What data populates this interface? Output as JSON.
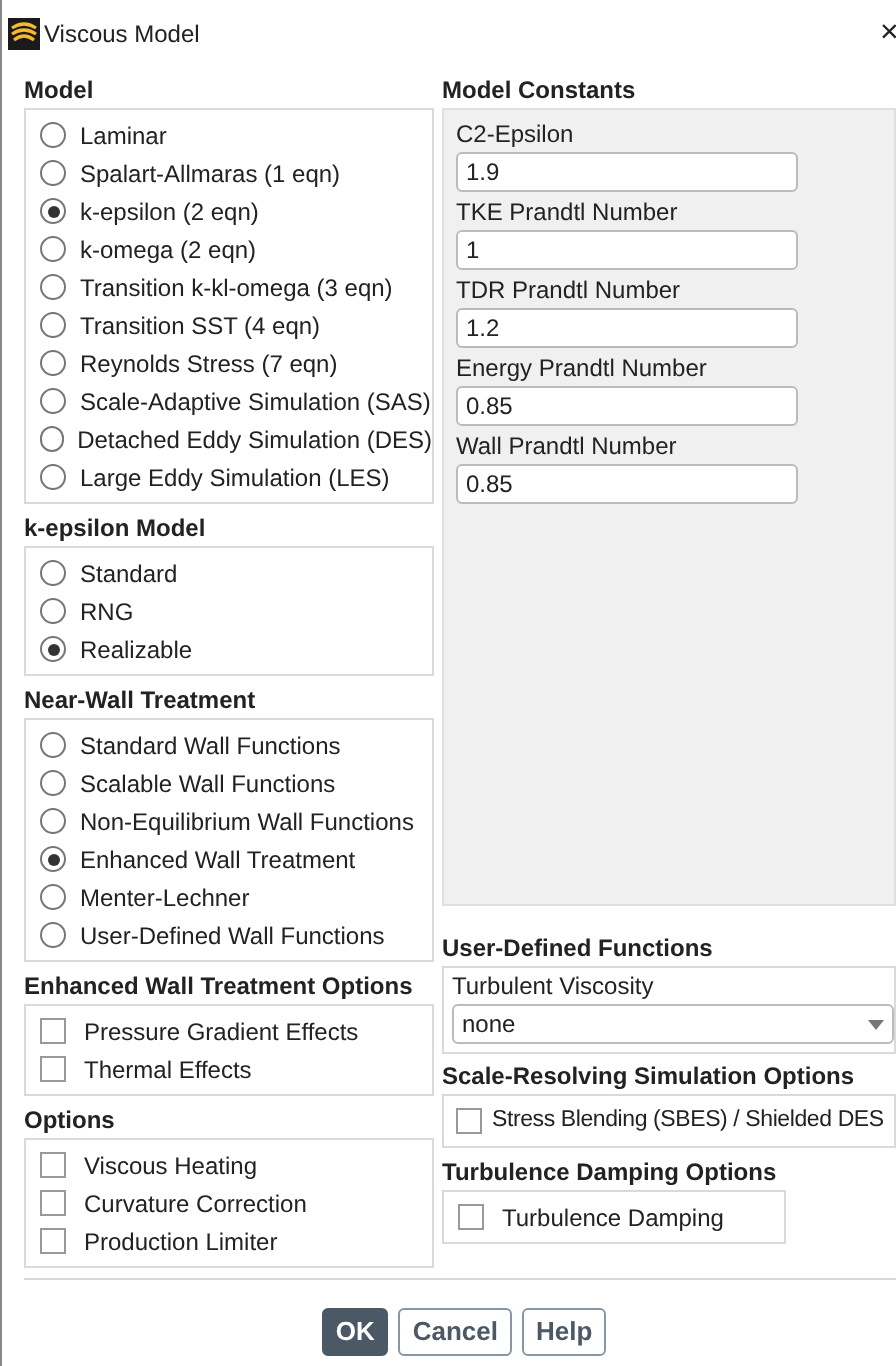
{
  "window": {
    "title": "Viscous Model",
    "close": "×"
  },
  "model": {
    "heading": "Model",
    "options": [
      {
        "label": "Laminar",
        "selected": false
      },
      {
        "label": "Spalart-Allmaras (1 eqn)",
        "selected": false
      },
      {
        "label": "k-epsilon (2 eqn)",
        "selected": true
      },
      {
        "label": "k-omega (2 eqn)",
        "selected": false
      },
      {
        "label": "Transition k-kl-omega (3 eqn)",
        "selected": false
      },
      {
        "label": "Transition SST (4 eqn)",
        "selected": false
      },
      {
        "label": "Reynolds Stress (7 eqn)",
        "selected": false
      },
      {
        "label": "Scale-Adaptive Simulation (SAS)",
        "selected": false
      },
      {
        "label": "Detached Eddy Simulation (DES)",
        "selected": false
      },
      {
        "label": "Large Eddy Simulation (LES)",
        "selected": false
      }
    ]
  },
  "k_epsilon_model": {
    "heading": "k-epsilon Model",
    "options": [
      {
        "label": "Standard",
        "selected": false
      },
      {
        "label": "RNG",
        "selected": false
      },
      {
        "label": "Realizable",
        "selected": true
      }
    ]
  },
  "near_wall_treatment": {
    "heading": "Near-Wall Treatment",
    "options": [
      {
        "label": "Standard Wall Functions",
        "selected": false
      },
      {
        "label": "Scalable Wall Functions",
        "selected": false
      },
      {
        "label": "Non-Equilibrium Wall Functions",
        "selected": false
      },
      {
        "label": "Enhanced Wall Treatment",
        "selected": true
      },
      {
        "label": "Menter-Lechner",
        "selected": false
      },
      {
        "label": "User-Defined Wall Functions",
        "selected": false
      }
    ]
  },
  "enhanced_wall_treatment_options": {
    "heading": "Enhanced Wall Treatment Options",
    "options": [
      {
        "label": "Pressure Gradient Effects",
        "checked": false
      },
      {
        "label": "Thermal Effects",
        "checked": false
      }
    ]
  },
  "options": {
    "heading": "Options",
    "options": [
      {
        "label": "Viscous Heating",
        "checked": false
      },
      {
        "label": "Curvature Correction",
        "checked": false
      },
      {
        "label": "Production Limiter",
        "checked": false
      }
    ]
  },
  "model_constants": {
    "heading": "Model Constants",
    "fields": [
      {
        "label": "C2-Epsilon",
        "value": "1.9"
      },
      {
        "label": "TKE Prandtl Number",
        "value": "1"
      },
      {
        "label": "TDR Prandtl Number",
        "value": "1.2"
      },
      {
        "label": "Energy Prandtl Number",
        "value": "0.85"
      },
      {
        "label": "Wall Prandtl Number",
        "value": "0.85"
      }
    ]
  },
  "user_defined_functions": {
    "heading": "User-Defined Functions",
    "label": "Turbulent Viscosity",
    "value": "none"
  },
  "scale_resolving_simulation_options": {
    "heading": "Scale-Resolving Simulation Options",
    "options": [
      {
        "label": "Stress Blending (SBES) / Shielded DES",
        "checked": false
      }
    ]
  },
  "turbulence_damping_options": {
    "heading": "Turbulence Damping Options",
    "options": [
      {
        "label": "Turbulence Damping",
        "checked": false
      }
    ]
  },
  "buttons": [
    {
      "label": "OK",
      "kind": "primary"
    },
    {
      "label": "Cancel",
      "kind": "secondary"
    },
    {
      "label": "Help",
      "kind": "secondary"
    }
  ]
}
